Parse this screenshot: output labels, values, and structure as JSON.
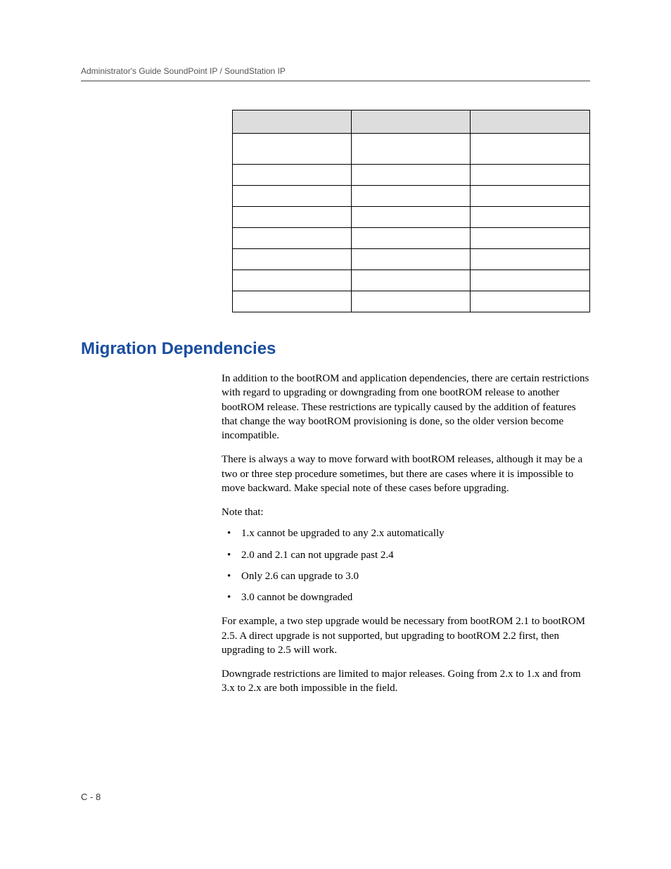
{
  "header": {
    "title": "Administrator's Guide SoundPoint IP / SoundStation IP"
  },
  "table": {
    "rows": 8
  },
  "section": {
    "heading": "Migration Dependencies",
    "para1": "In addition to the bootROM and application dependencies, there are certain restrictions with regard to upgrading or downgrading from one bootROM release to another bootROM release. These restrictions are typically caused by the addition of features that change the way bootROM provisioning is done, so the older version become incompatible.",
    "para2": "There is always a way to move forward with bootROM releases, although it may be a two or three step procedure sometimes, but there are cases where it is impossible to move backward. Make special note of these cases before upgrading.",
    "note_that": "Note that:",
    "bullets": [
      "1.x cannot be upgraded to any 2.x automatically",
      "2.0 and 2.1 can not upgrade past 2.4",
      "Only 2.6 can upgrade to 3.0",
      " 3.0 cannot be downgraded"
    ],
    "para3": "For example, a two step upgrade would be necessary from bootROM 2.1 to bootROM 2.5. A direct upgrade is not supported, but upgrading to bootROM 2.2 first, then upgrading to 2.5 will work.",
    "para4": "Downgrade restrictions are limited to major releases. Going from 2.x to 1.x and from 3.x to 2.x are both impossible in the field."
  },
  "footer": {
    "page_number": "C - 8"
  }
}
